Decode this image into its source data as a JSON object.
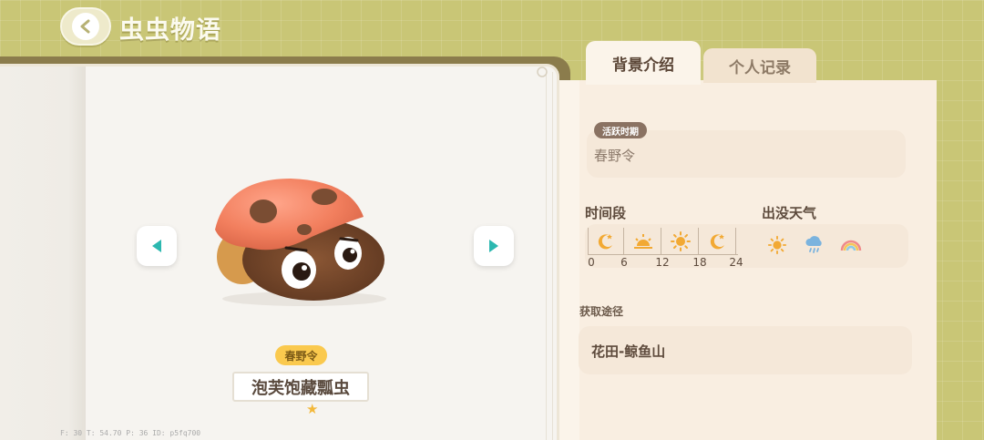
{
  "header": {
    "title": "虫虫物语",
    "back_icon": "back-arrow-icon"
  },
  "bug": {
    "name": "泡芙饱藏瓢虫",
    "season_badge": "春野令",
    "rarity_stars": 1,
    "nav_prev_icon": "left-triangle-icon",
    "nav_next_icon": "right-triangle-icon"
  },
  "tabs": [
    {
      "label": "背景介绍",
      "active": true
    },
    {
      "label": "个人记录",
      "active": false
    }
  ],
  "info": {
    "active_period_label": "活跃时期",
    "active_period_value": "春野令",
    "time_label": "时间段",
    "time_ticks": [
      "0",
      "6",
      "12",
      "18",
      "24"
    ],
    "time_slots": [
      {
        "icon": "moon-icon",
        "color": "#f2a933"
      },
      {
        "icon": "sunrise-icon",
        "color": "#f2a933"
      },
      {
        "icon": "sun-icon",
        "color": "#f2a933"
      },
      {
        "icon": "moon-icon",
        "color": "#f2a933"
      }
    ],
    "weather_label": "出没天气",
    "weather": [
      {
        "icon": "sun-icon"
      },
      {
        "icon": "rain-icon"
      },
      {
        "icon": "rainbow-icon"
      }
    ],
    "obtain_label": "获取途径",
    "obtain_value": "花田-鲸鱼山"
  },
  "debug_text": "F: 30   T: 54.70   P: 36   ID: p5fq700",
  "colors": {
    "background": "#c9c676",
    "accent_teal": "#2cb8b0",
    "badge_yellow": "#fac94e",
    "icon_orange": "#f2a933"
  }
}
